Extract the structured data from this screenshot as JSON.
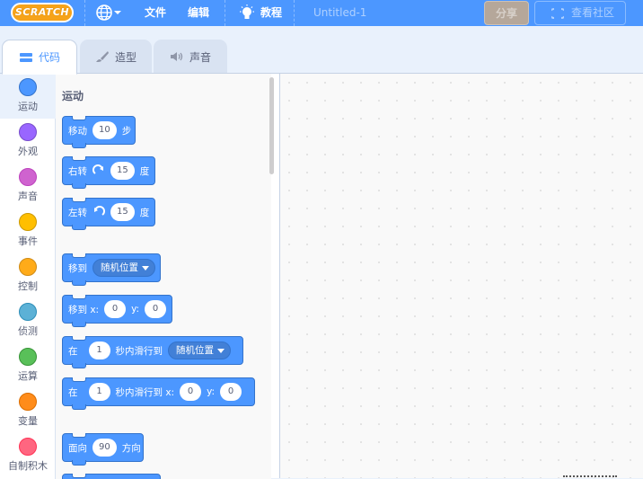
{
  "menubar": {
    "logo_text": "SCRATCH",
    "file_label": "文件",
    "edit_label": "编辑",
    "tutorials_label": "教程",
    "project_title": "Untitled-1",
    "share_label": "分享",
    "community_label": "查看社区"
  },
  "tabs": [
    {
      "label": "代码",
      "icon": "code-icon"
    },
    {
      "label": "造型",
      "icon": "brush-icon"
    },
    {
      "label": "声音",
      "icon": "speaker-icon"
    }
  ],
  "categories": [
    {
      "label": "运动",
      "color": "#4c97ff"
    },
    {
      "label": "外观",
      "color": "#9966ff"
    },
    {
      "label": "声音",
      "color": "#cf63cf"
    },
    {
      "label": "事件",
      "color": "#ffbf00"
    },
    {
      "label": "控制",
      "color": "#ffab19"
    },
    {
      "label": "侦测",
      "color": "#5cb1d6"
    },
    {
      "label": "运算",
      "color": "#59c059"
    },
    {
      "label": "变量",
      "color": "#ff8c1a"
    },
    {
      "label": "自制积木",
      "color": "#ff6680"
    }
  ],
  "palette": {
    "section_title": "运动",
    "blocks": {
      "move": {
        "label": "移动",
        "value": "10",
        "suffix": "步"
      },
      "turn_right": {
        "label": "右转",
        "value": "15",
        "suffix": "度"
      },
      "turn_left": {
        "label": "左转",
        "value": "15",
        "suffix": "度"
      },
      "goto": {
        "label": "移到",
        "dropdown": "随机位置"
      },
      "goto_xy": {
        "label": "移到 x:",
        "x": "0",
        "y_label": "y:",
        "y": "0"
      },
      "glide": {
        "label": "在",
        "secs": "1",
        "mid": "秒内滑行到",
        "dropdown": "随机位置"
      },
      "glide_xy": {
        "label": "在",
        "secs": "1",
        "mid": "秒内滑行到 x:",
        "x": "0",
        "y_label": "y:",
        "y": "0"
      },
      "point": {
        "label": "面向",
        "value": "90",
        "suffix": "方向"
      }
    }
  },
  "colors": {
    "menubar": "#4c97ff",
    "motion_block": "#4c97ff",
    "active_tab_text": "#4c97ff"
  }
}
